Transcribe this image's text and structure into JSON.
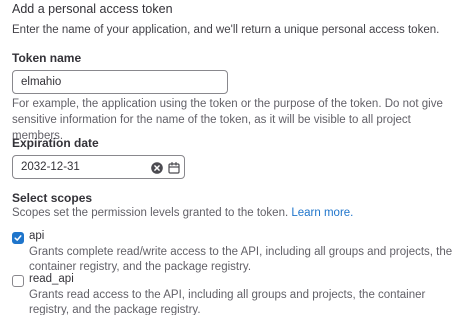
{
  "header": {
    "title": "Add a personal access token",
    "intro": "Enter the name of your application, and we'll return a unique personal access token."
  },
  "token_name": {
    "label": "Token name",
    "value": "elmahio",
    "help": "For example, the application using the token or the purpose of the token. Do not give sensitive information for the name of the token, as it will be visible to all project members."
  },
  "expiration": {
    "label": "Expiration date",
    "value": "2032-12-31",
    "icons": {
      "clear": "clear-icon",
      "calendar": "calendar-icon"
    }
  },
  "scopes": {
    "label": "Select scopes",
    "help": "Scopes set the permission levels granted to the token.",
    "learn_more": "Learn more.",
    "items": [
      {
        "name": "api",
        "checked": true,
        "description": "Grants complete read/write access to the API, including all groups and projects, the container registry, and the package registry."
      },
      {
        "name": "read_api",
        "checked": false,
        "description": "Grants read access to the API, including all groups and projects, the container registry, and the package registry."
      }
    ]
  },
  "colors": {
    "accent": "#1f75cb",
    "text": "#333238",
    "muted": "#626168",
    "border": "#89888d"
  }
}
